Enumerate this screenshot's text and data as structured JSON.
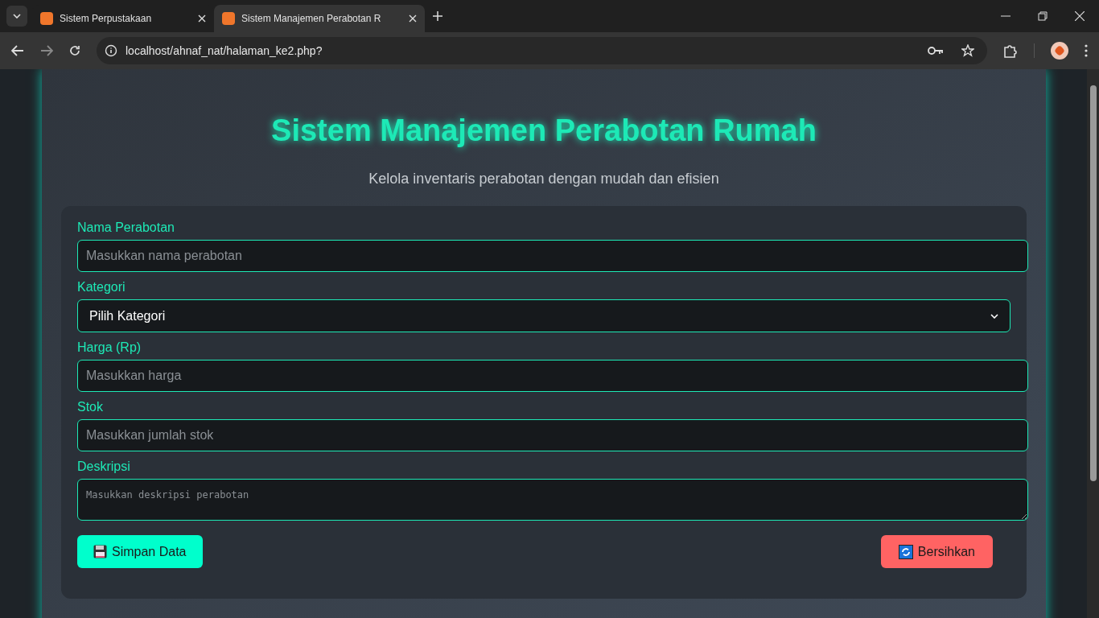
{
  "browser": {
    "tabs": [
      {
        "title": "Sistem Perpustakaan",
        "selected": false
      },
      {
        "title": "Sistem Manajemen Perabotan R",
        "selected": true
      }
    ],
    "url": "localhost/ahnaf_nat/halaman_ke2.php?"
  },
  "page": {
    "title": "Sistem Manajemen Perabotan Rumah",
    "subtitle": "Kelola inventaris perabotan dengan mudah dan efisien"
  },
  "form": {
    "fields": [
      {
        "kind": "input",
        "label": "Nama Perabotan",
        "placeholder": "Masukkan nama perabotan"
      },
      {
        "kind": "select",
        "label": "Kategori",
        "value": "Pilih Kategori"
      },
      {
        "kind": "input",
        "label": "Harga (Rp)",
        "placeholder": "Masukkan harga"
      },
      {
        "kind": "input",
        "label": "Stok",
        "placeholder": "Masukkan jumlah stok"
      },
      {
        "kind": "textarea",
        "label": "Deskripsi",
        "placeholder": "Masukkan deskripsi perabotan"
      }
    ],
    "buttons": [
      {
        "kind": "save",
        "label": "Simpan Data"
      },
      {
        "kind": "clear",
        "label": "Bersihkan"
      }
    ]
  }
}
